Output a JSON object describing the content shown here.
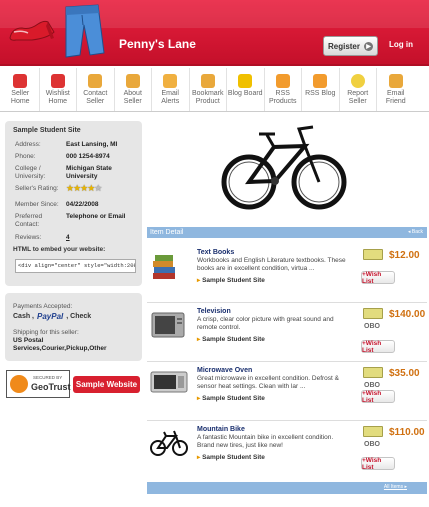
{
  "header": {
    "title": "Penny's Lane",
    "register": "Register",
    "login": "Log in"
  },
  "nav": [
    {
      "label": "Seller Home",
      "icon": "home-icon",
      "color": "#d33"
    },
    {
      "label": "Wishlist Home",
      "icon": "gift-icon",
      "color": "#d33"
    },
    {
      "label": "Contact Seller",
      "icon": "chat-icon",
      "color": "#e9a83b"
    },
    {
      "label": "About Seller",
      "icon": "folder-icon",
      "color": "#e9a83b"
    },
    {
      "label": "Email Alerts",
      "icon": "rss-icon",
      "color": "#f0b040"
    },
    {
      "label": "Bookmark Product",
      "icon": "bookmark-icon",
      "color": "#e9a83b"
    },
    {
      "label": "Blog Board",
      "icon": "speech-icon",
      "color": "#f0c000"
    },
    {
      "label": "RSS Products",
      "icon": "rss-icon",
      "color": "#f29b2d"
    },
    {
      "label": "RSS Blog",
      "icon": "rss-icon",
      "color": "#f29b2d"
    },
    {
      "label": "Report Seller",
      "icon": "bulb-icon",
      "color": "#f0d040"
    },
    {
      "label": "Email Friend",
      "icon": "mail-icon",
      "color": "#e9a83b"
    }
  ],
  "profile": {
    "name": "Sample Student Site",
    "address_label": "Address:",
    "address": "East Lansing, MI",
    "phone_label": "Phone:",
    "phone": "000 1254-8974",
    "college_label": "College / University:",
    "college": "Michigan State University",
    "rating_label": "Seller's Rating:",
    "rating": 4.5,
    "member_label": "Member Since:",
    "member": "04/22/2008",
    "contact_label": "Preferred Contact:",
    "contact": "Telephone or Email",
    "reviews_label": "Reviews:",
    "reviews": "4",
    "embed_label": "HTML to embed your website:",
    "embed_code": "<div align=\"center\" style=\"width:208px"
  },
  "payment": {
    "accepted_label": "Payments Accepted:",
    "cash": "Cash ,",
    "paypal": "PayPal",
    "check": ", Check",
    "shipping_label": "Shipping for this seller:",
    "shipping": "US Postal Services,Courier,Pickup,Other"
  },
  "badges": {
    "geotrust_top": "SECURED BY",
    "geotrust": "GeoTrust",
    "sample_website": "Sample Website"
  },
  "main": {
    "item_detail": "Item Detail",
    "back": "Back",
    "all_items": "All Items"
  },
  "items": [
    {
      "title": "Text Books",
      "desc": "Workbooks and English Literature textbooks. These books are in excellent condition, virtua ...",
      "seller": "Sample Student Site",
      "price": "$12.00",
      "obo": "",
      "wish": "+Wish List",
      "icon": "books-icon"
    },
    {
      "title": "Television",
      "desc": "A crisp, clear color picture with great sound and remote control.",
      "seller": "Sample Student Site",
      "price": "$140.00",
      "obo": "OBO",
      "wish": "+Wish List",
      "icon": "tv-icon"
    },
    {
      "title": "Microwave Oven",
      "desc": "Great microwave in excellent condition. Defrost & sensor heat settings. Clean with lar ...",
      "seller": "Sample Student Site",
      "price": "$35.00",
      "obo": "OBO",
      "wish": "+Wish List",
      "icon": "microwave-icon"
    },
    {
      "title": "Mountain Bike",
      "desc": "A fantastic Mountain bike in excellent condition. Brand new tires, just like new!",
      "seller": "Sample Student Site",
      "price": "$110.00",
      "obo": "OBO",
      "wish": "+Wish List",
      "icon": "bike-icon"
    }
  ]
}
